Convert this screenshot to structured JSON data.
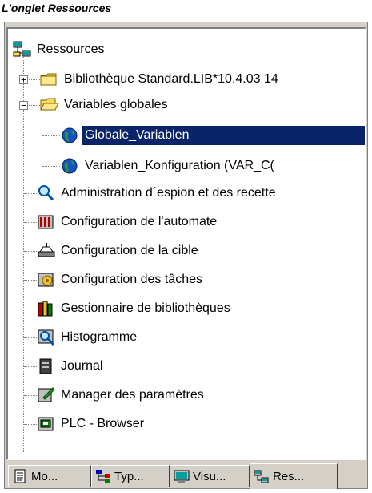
{
  "caption": "L'onglet Ressources",
  "tree": {
    "root_label": "Ressources",
    "lib_label": "Bibliothèque Standard.LIB*10.4.03 14",
    "vars_label": "Variables globales",
    "globale_label": "Globale_Variablen",
    "konfig_label": "Variablen_Konfiguration (VAR_C(",
    "items": [
      {
        "label": "Administration d´espion et des recette",
        "icon": "magnifier-icon"
      },
      {
        "label": "Configuration de l'automate",
        "icon": "plc-config-icon"
      },
      {
        "label": "Configuration de la cible",
        "icon": "target-icon"
      },
      {
        "label": "Configuration des tâches",
        "icon": "tasks-icon"
      },
      {
        "label": "Gestionnaire de bibliothèques",
        "icon": "library-icon"
      },
      {
        "label": "Histogramme",
        "icon": "histogram-icon"
      },
      {
        "label": "Journal",
        "icon": "journal-icon"
      },
      {
        "label": "Manager des paramètres",
        "icon": "parameters-icon"
      },
      {
        "label": "PLC - Browser",
        "icon": "browser-icon"
      }
    ]
  },
  "tabs": [
    {
      "label": "Mo...",
      "icon": "document-icon"
    },
    {
      "label": "Typ...",
      "icon": "types-icon"
    },
    {
      "label": "Visu...",
      "icon": "visualization-icon"
    },
    {
      "label": "Res...",
      "icon": "resources-icon"
    }
  ],
  "colors": {
    "selection": "#0a246a",
    "panel": "#d4d0c8",
    "folder": "#ffd95a"
  }
}
